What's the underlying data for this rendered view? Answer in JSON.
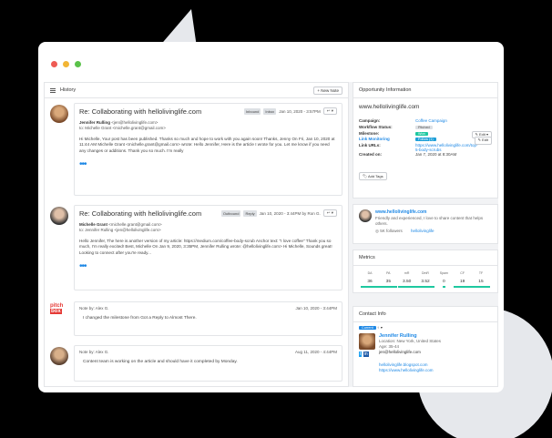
{
  "window": {
    "controls": [
      "close",
      "minimize",
      "maximize"
    ]
  },
  "history": {
    "title": "History",
    "new_note": "+ New Note",
    "threads": [
      {
        "subject": "Re: Collaborating with hellolivinglife.com",
        "tags": [
          "Inbound",
          "Inbox"
        ],
        "date": "Jan 10, 2020 - 3:57PM",
        "from": "Jennifer Rulling",
        "from_email": "<jen@hellolivinglife.com>",
        "to": "to: Michelle Grant <michelle.grant@gmail.com>",
        "body": "Hi Michelle, Your post has been published. Thanks so much and hope to work with you again soon! Thanks, Jenny On Fri, Jan 10, 2020 at 11:44 AM Michelle Grant <michelle.grant@gmail.com> wrote: Hello Jennifer, Here is the article I wrote for you. Let me know if you need any changes or additions. Thank you so much. I'm really",
        "more": "•••"
      },
      {
        "subject": "Re: Collaborating with hellolivinglife.com",
        "tags": [
          "Outbound",
          "Reply"
        ],
        "date": "Jan 10, 2020 - 3:44PM by Ron G.",
        "from": "Michelle Grant",
        "from_email": "<michelle.grant@gmail.com>",
        "to": "to: Jennifer Rulling <jen@hellolivinglife.com>",
        "body": "Hello Jennifer, The here is another version of my article: https://medium.com/coffee-body-scrub Anchor text: \"I love coffee\" Thank you so much, I'm really excited! Best, Michelle On Jan 9, 2020, 3:35PM, Jennifer Rulling wrote: @hellolivinglife.com> Hi Michelle, Sounds great! Looking to connect after you're ready...",
        "more": "•••"
      }
    ],
    "notes": [
      {
        "logo_top": "pitch",
        "logo_bottom": "box",
        "by": "Note by: Alex G.",
        "date": "Jan 10, 2020 - 3:44PM",
        "text": "I changed the milestone from Got a Reply to Almost There."
      },
      {
        "by": "Note by: Alex G.",
        "date": "Aug 11, 2020 - 4:44PM",
        "text": "Content team is working on the article and should have it completed by Monday."
      }
    ]
  },
  "opportunity": {
    "title": "Opportunity Information",
    "site": "www.hellolivinglife.com",
    "campaign_label": "Campaign:",
    "campaign": "Coffee Campaign",
    "workflow_label": "Workflow Status:",
    "workflow": "Pitched",
    "milestone_label": "Milestone:",
    "milestone": "Won",
    "link_monitoring_label": "Link Monitoring",
    "link_monitoring": "Follow (1)",
    "edit_label": "Edit",
    "link_urls_label": "Link URLs:",
    "link_url": "https://www.hellolivinglife.com/top-5-body-scrubs",
    "created_label": "Created on:",
    "created": "Jan 7, 2020 at 8:30AM",
    "add_tags": "Add Tags"
  },
  "profile": {
    "site": "www.hellolivinglife.com",
    "desc": "Friendly and experienced, I love to share content that helps others.",
    "followers": "5K followers",
    "handle": "hellolivinglife"
  },
  "metrics": {
    "title": "Metrics",
    "items": [
      {
        "label": "DA",
        "value": "36"
      },
      {
        "label": "PA",
        "value": "35"
      },
      {
        "label": "mR",
        "value": "3.50"
      },
      {
        "label": "DmR",
        "value": "3.52"
      },
      {
        "label": "Spam",
        "value": "0"
      },
      {
        "label": "CF",
        "value": "19"
      },
      {
        "label": "TF",
        "value": "15"
      }
    ]
  },
  "contact": {
    "title": "Contact Info",
    "status": "Current",
    "name": "Jennifer Rulling",
    "location": "Location: New York, United States",
    "age": "Age: 35-44",
    "email": "jen@hellolivinglife.com",
    "blog": "hellolivinglife.blogspot.com",
    "site": "https://www.hellolivinglife.com"
  }
}
